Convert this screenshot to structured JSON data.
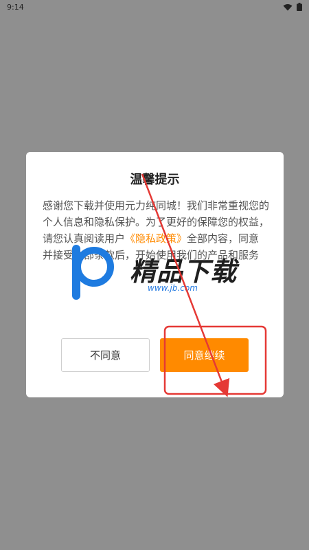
{
  "status_bar": {
    "time": "9:14"
  },
  "dialog": {
    "title": "温馨提示",
    "body_part1": "感谢您下载并使用元力纯同城！我们非常重视您的个人信息和隐私保护。为了更好的保障您的权益，请您认真阅读用户",
    "privacy_link": "《隐私政策》",
    "body_part2": "全部内容，同意并接受全部条款后，开始使用我们的产品和服务",
    "disagree_label": "不同意",
    "agree_label": "同意继续"
  },
  "watermark": {
    "brand": "精品下载",
    "url": "www.jb.com"
  },
  "colors": {
    "overlay": "#8f8f8f",
    "accent": "#ff8a00",
    "annotation": "#e53935"
  }
}
